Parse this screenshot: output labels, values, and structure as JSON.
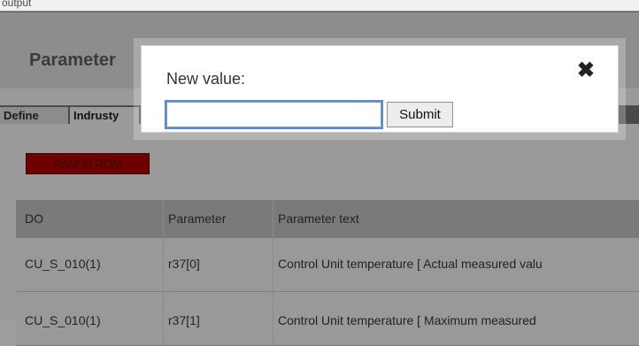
{
  "top_strip_text": "output",
  "page": {
    "title": "Parameter",
    "tabs": [
      "Define",
      "Indrusty"
    ],
    "ram_to_rom": "RAM to ROM"
  },
  "table": {
    "headers": [
      "DO",
      "Parameter",
      "Parameter text"
    ],
    "rows": [
      [
        "CU_S_010(1)",
        "r37[0]",
        "Control Unit temperature [ Actual measured valu"
      ],
      [
        "CU_S_010(1)",
        "r37[1]",
        "Control Unit temperature [ Maximum measured"
      ]
    ]
  },
  "modal": {
    "label": "New value:",
    "input_value": "",
    "submit_label": "Submit",
    "close_icon": "close-icon"
  }
}
